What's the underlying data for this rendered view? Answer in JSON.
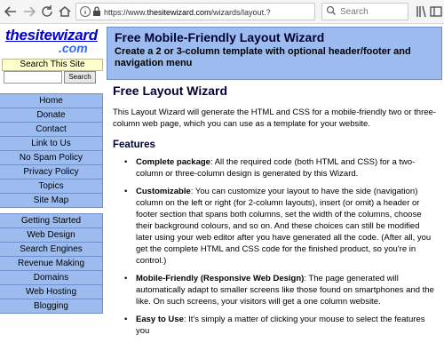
{
  "browser": {
    "url_prefix": "https://www.",
    "url_host": "thesitewizard.com",
    "url_path": "/wizards/layout.?",
    "search_placeholder": "Search"
  },
  "icons": {
    "back": "back-arrow-icon",
    "forward": "forward-arrow-icon",
    "reload": "reload-icon",
    "home": "home-icon",
    "info": "info-icon",
    "lock": "lock-icon",
    "page_actions": "page-actions-icon",
    "bookmark": "bookmark-star-icon",
    "search": "search-icon",
    "library": "library-icon",
    "sidebar": "sidebar-icon",
    "menu": "hamburger-menu-icon"
  },
  "site": {
    "logo_main": "thesitewizard",
    "logo_sub": ".com",
    "search_label": "Search This Site",
    "search_button": "Search",
    "search_value": ""
  },
  "nav1": [
    "Home",
    "Donate",
    "Contact",
    "Link to Us",
    "No Spam Policy",
    "Privacy Policy",
    "Topics",
    "Site Map"
  ],
  "nav2": [
    "Getting Started",
    "Web Design",
    "Search Engines",
    "Revenue Making",
    "Domains",
    "Web Hosting",
    "Blogging"
  ],
  "banner": {
    "title": "Free Mobile-Friendly Layout Wizard",
    "subtitle": "Create a 2 or 3-column template with optional header/footer and navigation menu"
  },
  "content": {
    "heading": "Free Layout Wizard",
    "intro": "This Layout Wizard will generate the HTML and CSS for a mobile-friendly two or three-column web page, which you can use as a template for your website.",
    "features_heading": "Features",
    "features": [
      {
        "title": "Complete package",
        "text": ": All the required code (both HTML and CSS) for a two-column or three-column design is generated by this Wizard."
      },
      {
        "title": "Customizable",
        "text": ": You can customize your layout to have the side (navigation) column on the left or right (for 2-column layouts), insert (or omit) a header or footer section that spans both columns, set the width of the columns, choose their background colours, and so on. And these choices can still be modified later using your web editor after you have generated all the code. (After all, you get the complete HTML and CSS code for the finished product, so you're in control.)"
      },
      {
        "title": "Mobile-Friendly (Responsive Web Design)",
        "text": ": The page generated will automatically adapt to smaller screens like those found on smartphones and the like. On such screens, your visitors will get a one column website."
      },
      {
        "title": "Easy to Use",
        "text": ": It's simply a matter of clicking your mouse to select the features you"
      }
    ]
  },
  "colors": {
    "nav_bg": "#9cbcf0",
    "nav_border": "#6f8fcf",
    "logo_blue": "#0000cc",
    "search_label_bg": "#ffffcc"
  }
}
